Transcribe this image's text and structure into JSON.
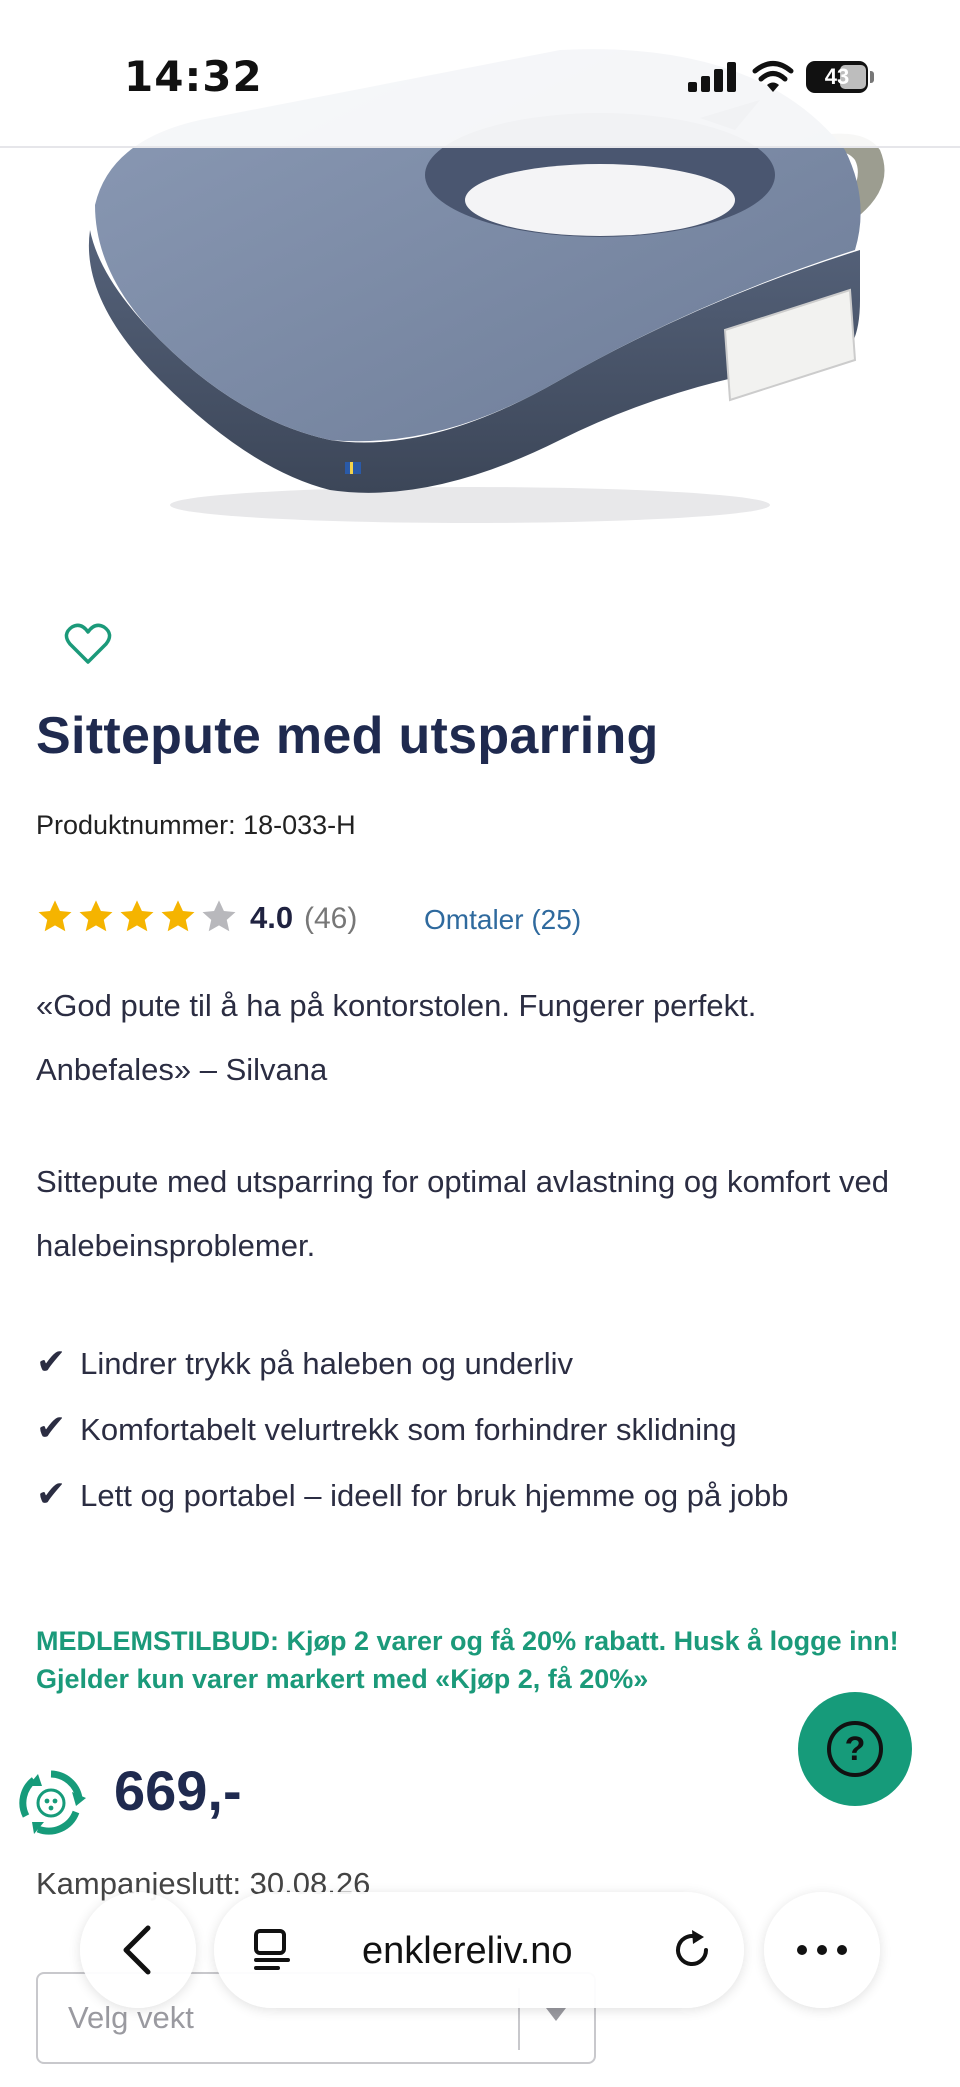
{
  "status_bar": {
    "time": "14:32",
    "battery": "43"
  },
  "product": {
    "title": "Sittepute med utsparring",
    "sku_label": "Produktnummer: 18-033-H",
    "rating": {
      "value": "4.0",
      "count": "(46)",
      "stars": 4,
      "max_stars": 5
    },
    "reviews_link": "Omtaler (25)",
    "quote": "«God pute til å ha på kontorstolen. Fungerer perfekt. Anbefales» – Silvana",
    "description": "Sittepute med utsparring for optimal avlastning og komfort ved halebeinsproblemer.",
    "features": [
      {
        "check": "✔",
        "text": "Lindrer trykk på haleben og underliv"
      },
      {
        "check": "✔",
        "text": "Komfortabelt velurtrekk som forhindrer sklidning"
      },
      {
        "check": "✔",
        "text": "Lett og portabel – ideell for bruk hjemme og på jobb"
      }
    ],
    "promo": "MEDLEMSTILBUD: Kjøp 2 varer og få 20% rabatt. Husk å logge inn! Gjelder kun varer markert med «Kjøp 2, få 20%»",
    "price": "669,-",
    "campaign_end": "Kampanjeslutt: 30.08.26",
    "select": {
      "value": "Velg vekt"
    }
  },
  "help_button": {
    "label": "?"
  },
  "browser": {
    "url": "enklereliv.no"
  },
  "colors": {
    "accent": "#169b7a",
    "title": "#1f2a4f",
    "link": "#2f6a9e",
    "star": "#f5b400"
  }
}
